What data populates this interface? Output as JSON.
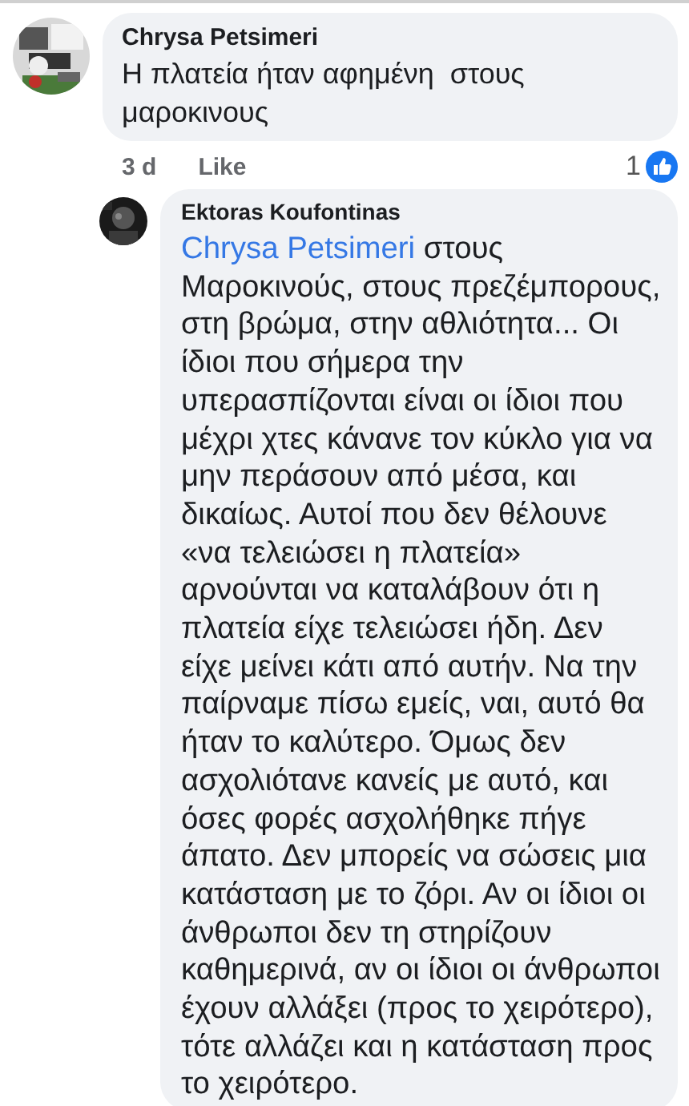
{
  "comment": {
    "author": "Chrysa Petsimeri",
    "text": "Η πλατεία ήταν αφημένη  στους μαροκινους",
    "time": "3 d",
    "like_label": "Like",
    "reaction_count": "1"
  },
  "reply": {
    "author": "Ektoras Koufontinas",
    "mention": "Chrysa Petsimeri",
    "text": "στους Μαροκινούς, στους πρεζέμπορους, στη βρώμα, στην αθλιότητα... Οι ίδιοι που σήμερα την υπερασπίζονται είναι οι ίδιοι που μέχρι χτες κάνανε τον κύκλο για να μην περάσουν από μέσα, και δικαίως. Αυτοί που δεν θέλουνε «να τελειώσει η πλατεία» αρνούνται να καταλάβουν ότι η πλατεία είχε τελειώσει ήδη. Δεν είχε μείνει κάτι από αυτήν. Να την παίρναμε πίσω εμείς, ναι, αυτό θα ήταν το καλύτερο. Όμως δεν ασχολιότανε κανείς με αυτό, και όσες φορές ασχολήθηκε πήγε άπατο. Δεν μπορείς να σώσεις μια κατάσταση με το ζόρι. Αν οι ίδιοι οι άνθρωποι δεν τη στηρίζουν καθημερινά, αν οι ίδιοι οι άνθρωποι έχουν αλλάξει (προς το χειρότερο), τότε αλλάζει και η κατάσταση προς το χειρότερο."
  }
}
